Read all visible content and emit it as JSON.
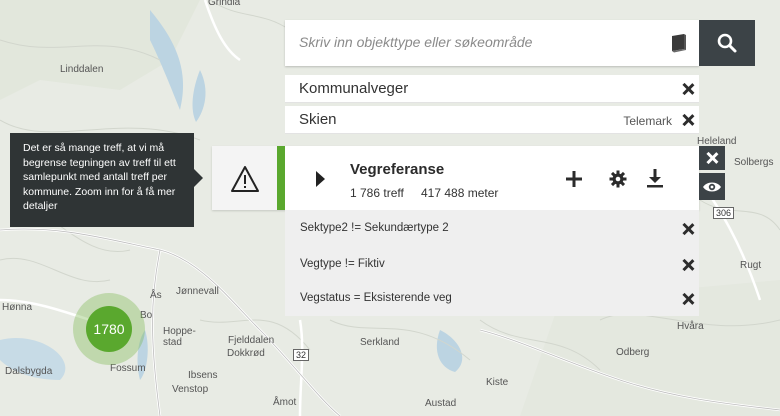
{
  "map": {
    "places": [
      "Grindla",
      "Linddalen",
      "Dalsbygda",
      "Fossum",
      "Jønnevall",
      "Fjelddalen",
      "Ås",
      "Hoppe-stad",
      "Dokkrød",
      "Ibsens",
      "Venstop",
      "Åmot",
      "Serkland",
      "Austad",
      "Kiste",
      "Odberg",
      "Hvåra",
      "Solbergs",
      "Heleland",
      "Hønna",
      "Rugt",
      "Bo"
    ],
    "road_numbers": [
      "32",
      "306"
    ]
  },
  "tooltip": {
    "text": "Det er så mange treff, at vi må begrense tegningen av treff til ett samlepunkt med antall treff per kommune. Zoom inn for å få mer detaljer"
  },
  "cluster": {
    "count": "1780",
    "color": "#5aa82e"
  },
  "search": {
    "placeholder": "Skriv inn objekttype eller søkeområde",
    "value": "",
    "book_icon": "book-icon",
    "button_icon": "search-icon"
  },
  "filters": [
    {
      "label": "Kommunalveger",
      "sub": ""
    },
    {
      "label": "Skien",
      "sub": "Telemark"
    }
  ],
  "result": {
    "title": "Vegreferanse",
    "count": "1 786 treff",
    "length": "417 488 meter",
    "accent": "#5aa82e",
    "actions": [
      "plus-icon",
      "gear-icon",
      "download-icon"
    ]
  },
  "side_buttons": [
    "close-icon",
    "eye-icon"
  ],
  "conditions": [
    "Sektype2 != Sekundærtype 2",
    "Vegtype != Fiktiv",
    "Vegstatus = Eksisterende veg"
  ]
}
